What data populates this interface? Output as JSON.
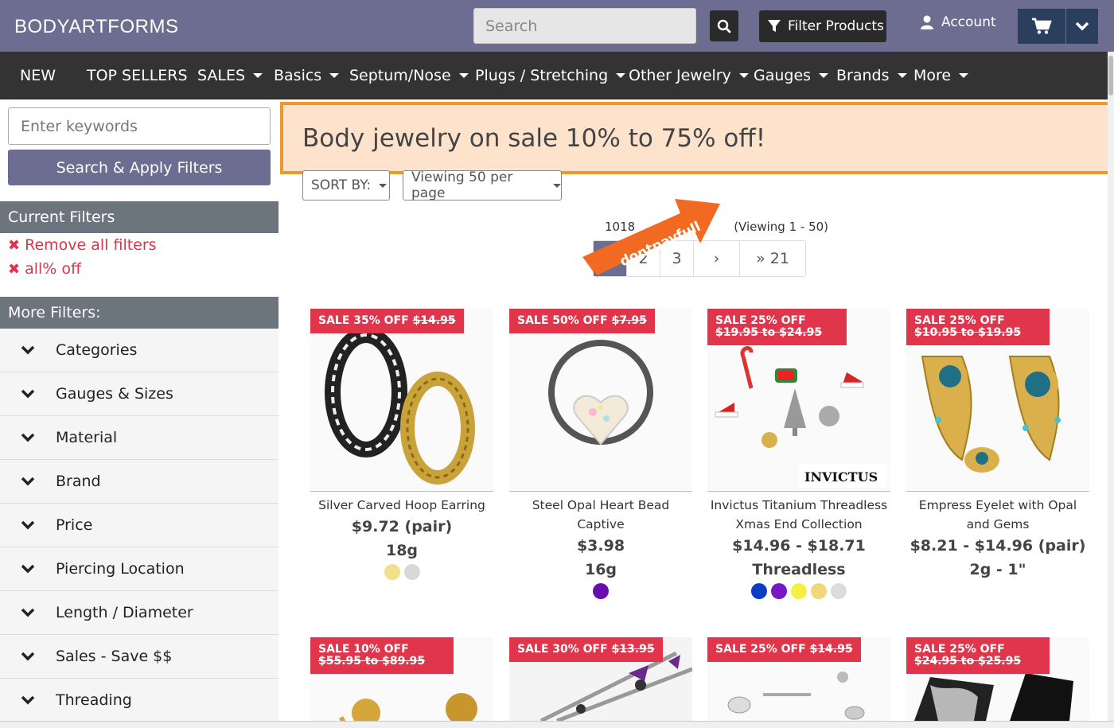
{
  "header": {
    "logo": "BODYARTFORMS",
    "search_placeholder": "Search",
    "filter_button": "Filter Products",
    "account_label": "Account"
  },
  "nav": [
    {
      "label": "NEW",
      "dropdown": false
    },
    {
      "label": "TOP SELLERS",
      "dropdown": false
    },
    {
      "label": "SALES",
      "dropdown": true
    },
    {
      "label": "Basics",
      "dropdown": true
    },
    {
      "label": "Septum/Nose",
      "dropdown": true
    },
    {
      "label": "Plugs / Stretching",
      "dropdown": true
    },
    {
      "label": "Other Jewelry",
      "dropdown": true
    },
    {
      "label": "Gauges",
      "dropdown": true
    },
    {
      "label": "Brands",
      "dropdown": true
    },
    {
      "label": "More",
      "dropdown": true
    }
  ],
  "sidebar": {
    "keyword_placeholder": "Enter keywords",
    "apply_button": "Search & Apply Filters",
    "current_filters_title": "Current Filters",
    "current_filters": [
      "Remove all filters",
      "all% off"
    ],
    "more_filters_title": "More Filters:",
    "facets": [
      "Categories",
      "Gauges & Sizes",
      "Material",
      "Brand",
      "Price",
      "Piercing Location",
      "Length / Diameter",
      "Sales - Save $$",
      "Threading"
    ]
  },
  "main": {
    "banner": "Body jewelry on sale 10% to 75% off!",
    "sort_label": "SORT BY:",
    "per_page_label": "Viewing 50 per page",
    "result_count_prefix": "1018",
    "result_count_suffix": "(Viewing 1 - 50)",
    "pagination": [
      "1",
      "2",
      "3",
      "›",
      "» 21"
    ],
    "promo_watermark": "dontpayfull"
  },
  "products": [
    {
      "sale": "SALE 35% OFF",
      "old": "$14.95",
      "name": "Silver Carved Hoop Earring",
      "price": "$9.72 (pair)",
      "gauge": "18g",
      "swatches": [
        "#f0e08a",
        "#d8d8d8"
      ]
    },
    {
      "sale": "SALE 50% OFF",
      "old": "$7.95",
      "name": "Steel Opal Heart Bead Captive",
      "price": "$3.98",
      "gauge": "16g",
      "swatches": [
        "#6a0dad"
      ]
    },
    {
      "sale": "SALE 25% OFF",
      "old": "$19.95 to $24.95",
      "name": "Invictus Titanium Threadless Xmas End Collection",
      "price": "$14.96 - $18.71",
      "gauge": "Threadless",
      "swatches": [
        "#0a3cc4",
        "#7b16c6",
        "#f3f040",
        "#f0d87a",
        "#dcdcdc"
      ],
      "brand_badge": "INVICTUS"
    },
    {
      "sale": "SALE 25% OFF",
      "old": "$10.95 to $19.95",
      "name": "Empress Eyelet with Opal and Gems",
      "price": "$8.21 - $14.96 (pair)",
      "gauge": "2g - 1\"",
      "swatches": []
    },
    {
      "sale": "SALE 10% OFF",
      "old": "$55.95 to $89.95",
      "name": "",
      "price": "",
      "gauge": "",
      "swatches": []
    },
    {
      "sale": "SALE 30% OFF",
      "old": "$13.95",
      "name": "",
      "price": "",
      "gauge": "",
      "swatches": []
    },
    {
      "sale": "SALE 25% OFF",
      "old": "$14.95",
      "name": "",
      "price": "",
      "gauge": "",
      "swatches": []
    },
    {
      "sale": "SALE 25% OFF",
      "old": "$24.95 to $25.95",
      "name": "",
      "price": "",
      "gauge": "",
      "swatches": []
    }
  ],
  "colors": {
    "header_bg": "#6d6d92",
    "nav_bg": "#333333",
    "sale_red": "#e0354a",
    "banner_bg": "#fde3cc",
    "banner_border": "#f0962e"
  }
}
